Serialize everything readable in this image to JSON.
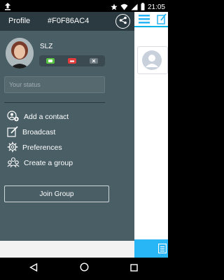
{
  "status_bar": {
    "time": "21:05",
    "icons": [
      "upload-icon",
      "star-icon",
      "wifi-icon",
      "signal-icon",
      "battery-icon"
    ]
  },
  "drawer": {
    "profile_label": "Profile",
    "profile_id": "#F0F86AC4",
    "username": "SLZ",
    "status_placeholder": "Your status",
    "status_pills": [
      "green",
      "red",
      "gray"
    ],
    "menu": [
      {
        "label": "Add a contact",
        "icon": "add-contact-icon"
      },
      {
        "label": "Broadcast",
        "icon": "broadcast-icon"
      },
      {
        "label": "Preferences",
        "icon": "gear-icon"
      },
      {
        "label": "Create a group",
        "icon": "group-icon"
      }
    ],
    "join_group_label": "Join Group"
  },
  "colors": {
    "drawer_bg": "#4a5e66",
    "header_bg": "#2b3a41",
    "accent": "#29b6f6",
    "status_green": "#58c243",
    "status_red": "#e23b3b"
  },
  "nav": {
    "items": [
      "back-icon",
      "home-icon",
      "recents-icon"
    ]
  }
}
